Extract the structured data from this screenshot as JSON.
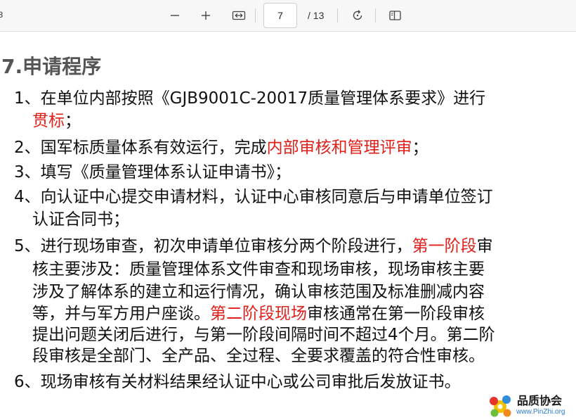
{
  "toolbar": {
    "zoom_out_icon": "minus-icon",
    "zoom_in_icon": "plus-icon",
    "fit_width_icon": "fit-width-icon",
    "current_page": "7",
    "total_pages": "/ 13",
    "rotate_icon": "rotate-icon",
    "page_view_icon": "page-view-icon"
  },
  "document": {
    "heading": "7.申请程序",
    "items": [
      {
        "num": "1、",
        "lines": [
          [
            "在单位内部按照《GJB9001C-20017质量管理体系要求》进行"
          ],
          [
            "贯标",
            ";"
          ]
        ]
      },
      {
        "num": "2、",
        "text_a": "国军标质量体系有效运行，完成",
        "red": "内部审核和管理评审",
        "text_b": "；"
      },
      {
        "num": "3、",
        "text": "填写《质量管理体系认证申请书》；"
      },
      {
        "num": "4、",
        "line1": "向认证中心提交申请材料，认证中心审核同意后与申请单位签订",
        "line2": "认证合同书；"
      },
      {
        "num": "5、",
        "line1_a": "进行现场审查，初次申请单位审核分两个阶段进行，",
        "line1_red": "第一阶段",
        "line1_b": "审",
        "line2": "核主要涉及：质量管理体系文件审查和现场审核，现场审核主要",
        "line3": "涉及了解体系的建立和运行情况，确认审核范围及标准删减内容",
        "line4_a": "等，并与军方用户座谈。",
        "line4_red": "第二阶段现场",
        "line4_b": "审核通常在第一阶段审核",
        "line5": "提出问题关闭后进行，与第一阶段间隔时间不超过4个月。第二阶",
        "line6": "段审核是全部门、全产品、全过程、全要求覆盖的符合性审核。"
      },
      {
        "num": "6、",
        "text": "现场审核有关材料结果经认证中心或公司审批后发放证书。"
      }
    ],
    "item1_line1": "在单位内部按照《GJB9001C-20017质量管理体系要求》进行",
    "item1_red": "贯标",
    "item1_end": "；"
  },
  "watermark": {
    "name": "品质协会",
    "url": "www.PinZhi.org"
  },
  "colors": {
    "highlight": "#e0201b",
    "heading": "#555555"
  }
}
